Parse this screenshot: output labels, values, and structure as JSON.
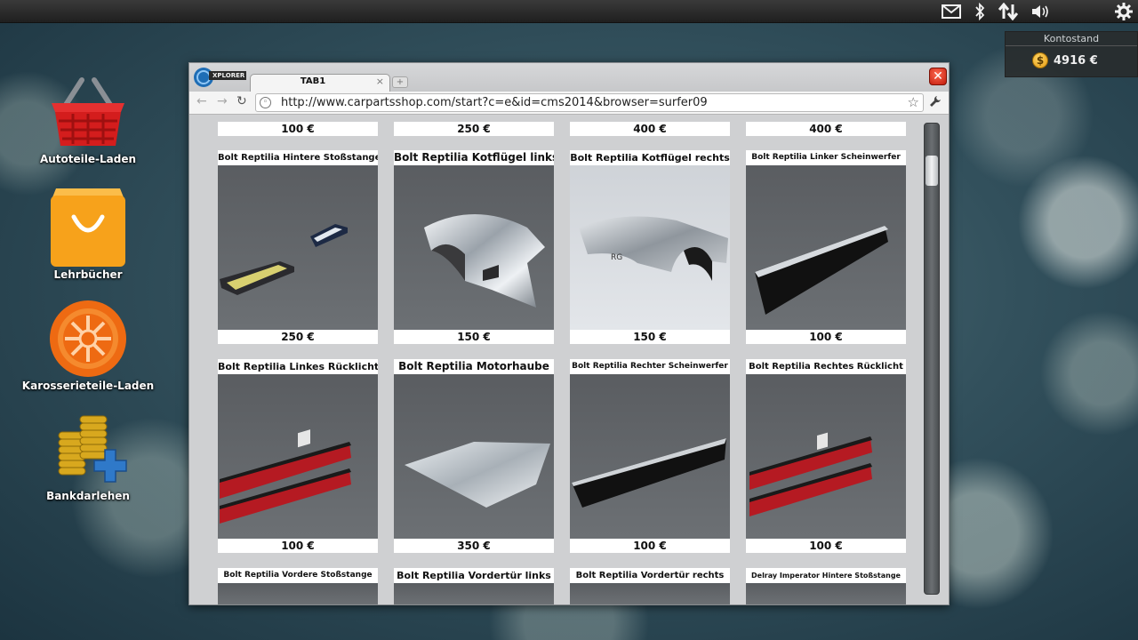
{
  "topbar": {
    "icons": [
      "mail-icon",
      "bluetooth-icon",
      "network-arrows-icon",
      "volume-icon",
      "settings-gear-icon"
    ]
  },
  "account": {
    "title": "Kontostand",
    "balance": "4916 €",
    "coin_symbol": "$"
  },
  "desktop": {
    "items": [
      {
        "label": "Autoteile-Laden",
        "icon": "shopping-basket-icon"
      },
      {
        "label": "Lehrbücher",
        "icon": "shopping-bag-icon"
      },
      {
        "label": "Karosserieteile-Laden",
        "icon": "wheel-icon"
      },
      {
        "label": "Bankdarlehen",
        "icon": "coins-plus-icon"
      }
    ]
  },
  "browser": {
    "logo_text": "XPLORER",
    "tab_label": "TAB1",
    "tab_close": "×",
    "new_tab": "+",
    "close_button": "✕",
    "url": "http://www.carpartsshop.com/start?c=e&id=cms2014&browser=surfer09"
  },
  "shop": {
    "top_prices": [
      "100 €",
      "250 €",
      "400 €",
      "400 €"
    ],
    "row1": [
      {
        "title": "Bolt Reptilia Hintere Stoßstange",
        "price": "250 €",
        "part": "rear-bumper-icon"
      },
      {
        "title": "Bolt Reptilia Kotflügel links",
        "price": "150 €",
        "part": "fender-left-icon"
      },
      {
        "title": "Bolt Reptilia Kotflügel rechts",
        "price": "150 €",
        "part": "fender-right-icon"
      },
      {
        "title": "Bolt Reptilia Linker Scheinwerfer",
        "price": "100 €",
        "part": "headlight-left-icon"
      }
    ],
    "row2": [
      {
        "title": "Bolt Reptilia Linkes Rücklicht",
        "price": "100 €",
        "part": "taillight-left-icon"
      },
      {
        "title": "Bolt Reptilia Motorhaube",
        "price": "350 €",
        "part": "hood-icon"
      },
      {
        "title": "Bolt Reptilia Rechter Scheinwerfer",
        "price": "100 €",
        "part": "headlight-right-icon"
      },
      {
        "title": "Bolt Reptilia Rechtes Rücklicht",
        "price": "100 €",
        "part": "taillight-right-icon"
      }
    ],
    "row3": [
      {
        "title": "Bolt Reptilia Vordere Stoßstange"
      },
      {
        "title": "Bolt Reptilia Vordertür links"
      },
      {
        "title": "Bolt Reptilia Vordertür rechts"
      },
      {
        "title": "Delray Imperator Hintere Stoßstange"
      }
    ]
  }
}
